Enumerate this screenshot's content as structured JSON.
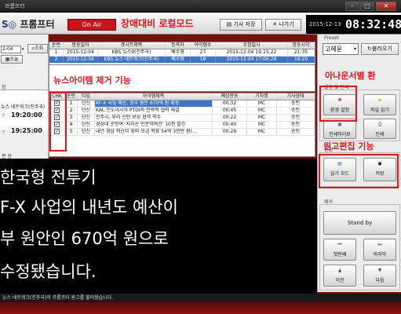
{
  "window": {
    "title": "프롬프터"
  },
  "toolbar": {
    "logo_prefix": "S",
    "logo_text": "프롬프터",
    "on_air": "On Air",
    "save_article": "기사 저장",
    "exit": "나가기"
  },
  "clock": {
    "date": "2015-12-13",
    "time": "08:32:48"
  },
  "annotations": {
    "local_mode": "장애대비 로컬모드",
    "remove_item": "뉴스아이템 제거 기능",
    "announcer_switch": "아나운서별 환",
    "script_edit": "원고편집 기능"
  },
  "left": {
    "date_value": "2-04",
    "query_button": "조회",
    "today_button": "오늘",
    "section_label": "장",
    "program_name": "뉴스 네트워크(진주국)",
    "times": [
      "19:20:00",
      "19:25:00"
    ],
    "bottom_label": "편 장"
  },
  "rundown_table": {
    "headers": [
      "순번",
      "방송일자",
      "큐시트제목",
      "등록자",
      "아이템수",
      "수정일시",
      "방송시각"
    ],
    "rows": [
      [
        "1",
        "2015-12-04",
        "KBS 뉴스9(진주국)",
        "배수영",
        "27",
        "2015-12-04 19:15:22",
        "21:35"
      ],
      [
        "2",
        "2015-12-04",
        "KBS 뉴스 네트워크(진주국)",
        "배수영",
        "18",
        "2015-12-04 17:06:28",
        "19:20"
      ]
    ]
  },
  "items_table": {
    "headers": [
      "CHK",
      "순번",
      "타입",
      "아이템제목",
      "예상방송",
      "기자명",
      "기사상태"
    ],
    "rows": [
      [
        "✓",
        "1",
        "단신",
        "KF-X 사업 예산, 정부 원안 670억 원 확정",
        "00:32",
        "MC",
        "승인"
      ],
      [
        "✓",
        "2",
        "단신",
        "KAI, 인도네시아 PTDI와 전략적 협력 체결",
        "00:45",
        "MC",
        "승인"
      ],
      [
        "✓",
        "3",
        "단신",
        "진주시, 부리 신탄 보상 협약 착수",
        "00:22",
        "MC",
        "승인"
      ],
      [
        "✓",
        "4",
        "단신",
        "경상대 순방여 '지리산 인문학여건' 10권 발간",
        "00:40",
        "MC",
        "승인"
      ],
      [
        "✓",
        "5",
        "단신",
        "내년 경남 적산자 회비 모금 목표 54억 3천만 원(...",
        "00:29",
        "MC",
        "승인"
      ]
    ]
  },
  "right": {
    "preset_label": "Preset",
    "announcer": "고혜윤",
    "load_button": "불러오기",
    "settings_label": "설정 및 인쇄",
    "env_settings": "환경 설정",
    "file_read": "파일 읽기",
    "print_preview": "인쇄미리보",
    "print": "인쇄",
    "edit_label": "편집",
    "read_mode": "읽기 모드",
    "save": "저장",
    "control_label": "제어",
    "stand_by": "Stand by",
    "first_page": "첫번째",
    "last_page": "마지막",
    "prev": "이전",
    "next": "다음"
  },
  "prompter": {
    "lines": [
      "한국형 전투기",
      "F-X 사업의 내년도 예산이",
      "부 원안인 670억 원으로",
      "수정됐습니다."
    ]
  },
  "status": {
    "message": "뉴스 네트워크(진주국)의 프롬프터 원고를 불러왔습니다."
  },
  "colors": {
    "accent_red": "#e0141a",
    "on_air_red": "#c8141a",
    "selection_blue": "#3d76c8"
  }
}
